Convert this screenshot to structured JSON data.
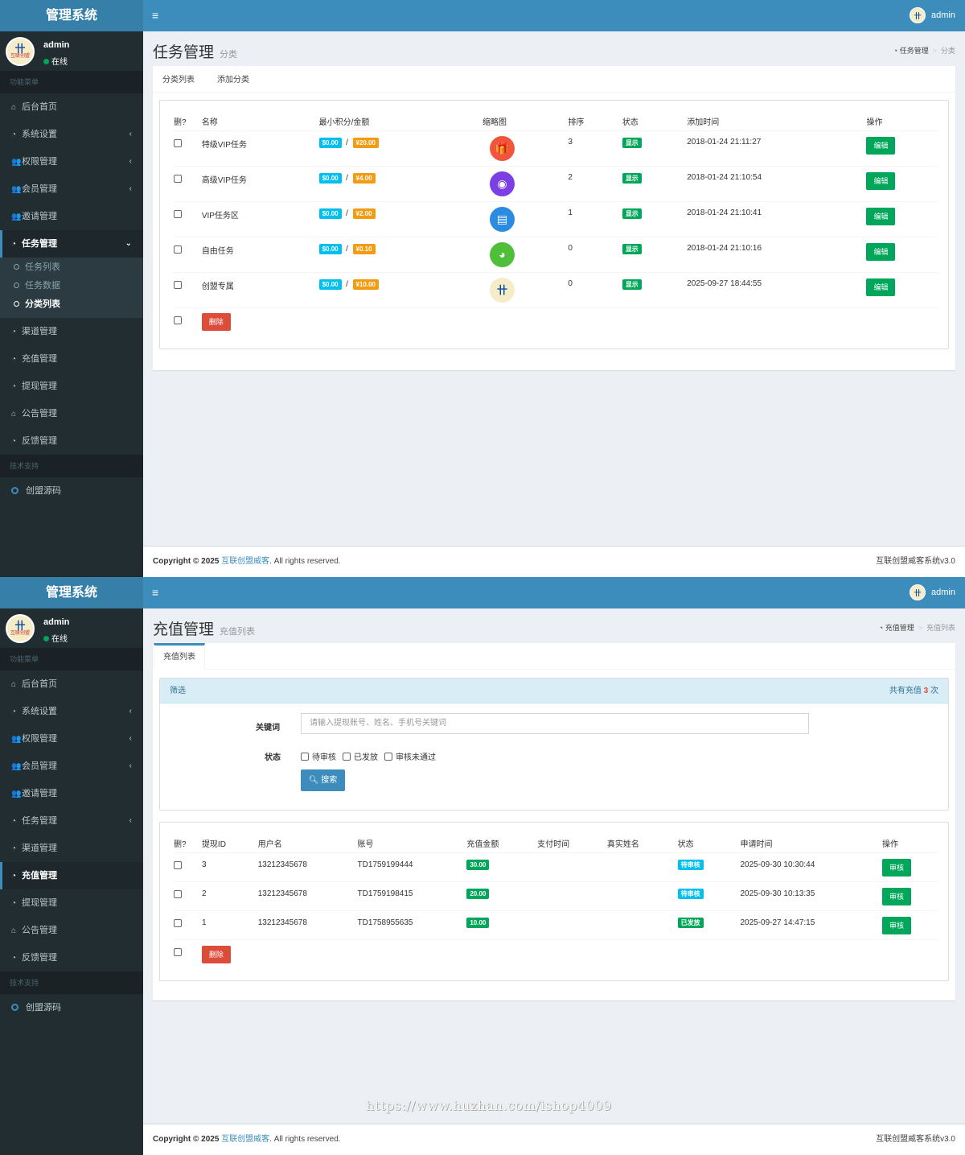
{
  "app_title": "管理系统",
  "user": {
    "name": "admin",
    "status": "在线"
  },
  "avatar_text": "互联创盟",
  "menu_header": "功能菜单",
  "support_header": "技术支持",
  "support_item": "创盟源码",
  "footer": {
    "copyright": "Copyright © 2025",
    "company": "互联创盟威客",
    "rights": ". All rights reserved.",
    "version": "互联创盟威客系统v3.0"
  },
  "screen1": {
    "title": "任务管理",
    "subtitle": "分类",
    "crumb": [
      "任务管理",
      "分类"
    ],
    "menu": [
      {
        "label": "后台首页",
        "icon": "home-icon",
        "chevron": false
      },
      {
        "label": "系统设置",
        "icon": "dashboard-icon",
        "chevron": true
      },
      {
        "label": "权限管理",
        "icon": "users-icon",
        "chevron": true
      },
      {
        "label": "会员管理",
        "icon": "users-icon",
        "chevron": true
      },
      {
        "label": "邀请管理",
        "icon": "users-icon",
        "chevron": false
      },
      {
        "label": "任务管理",
        "icon": "dashboard-icon",
        "chevron": true,
        "active": true
      }
    ],
    "submenu": [
      {
        "label": "任务列表"
      },
      {
        "label": "任务数据"
      },
      {
        "label": "分类列表",
        "active": true
      }
    ],
    "menu_after": [
      {
        "label": "渠道管理",
        "icon": "dashboard-icon"
      },
      {
        "label": "充值管理",
        "icon": "dashboard-icon"
      },
      {
        "label": "提现管理",
        "icon": "dashboard-icon"
      },
      {
        "label": "公告管理",
        "icon": "home-icon"
      },
      {
        "label": "反馈管理",
        "icon": "dashboard-icon"
      }
    ],
    "tabs": [
      "分类列表",
      "添加分类"
    ],
    "columns": [
      "删?",
      "名称",
      "最小积分/金额",
      "缩略图",
      "排序",
      "状态",
      "添加时间",
      "操作"
    ],
    "rows": [
      {
        "name": "特级VIP任务",
        "min_points": "$0.00",
        "amount": "¥20.00",
        "icon": "gift-icon",
        "color": "#f2553c",
        "order": "3",
        "status": "显示",
        "time": "2018-01-24 21:11:27",
        "action": "编辑"
      },
      {
        "name": "高级VIP任务",
        "min_points": "$0.00",
        "amount": "¥4.00",
        "icon": "qq-penguin-icon",
        "color": "#7b3fe4",
        "order": "2",
        "status": "显示",
        "time": "2018-01-24 21:10:54",
        "action": "编辑"
      },
      {
        "name": "VIP任务区",
        "min_points": "$0.00",
        "amount": "¥2.00",
        "icon": "document-icon",
        "color": "#2b8be0",
        "order": "1",
        "status": "显示",
        "time": "2018-01-24 21:10:41",
        "action": "编辑"
      },
      {
        "name": "自由任务",
        "min_points": "$0.00",
        "amount": "¥0.10",
        "icon": "wechat-icon",
        "color": "#4fbe3a",
        "order": "0",
        "status": "显示",
        "time": "2018-01-24 21:10:16",
        "action": "编辑"
      },
      {
        "name": "创盟专属",
        "min_points": "$0.00",
        "amount": "¥10.00",
        "icon": "logo-icon",
        "color": "#f5edc8",
        "order": "0",
        "status": "显示",
        "time": "2025-09-27 18:44:55",
        "action": "编辑"
      }
    ],
    "delete_label": "删除"
  },
  "screen2": {
    "title": "充值管理",
    "subtitle": "充值列表",
    "crumb": [
      "充值管理",
      "充值列表"
    ],
    "menu": [
      {
        "label": "后台首页",
        "icon": "home-icon",
        "chevron": false
      },
      {
        "label": "系统设置",
        "icon": "dashboard-icon",
        "chevron": true
      },
      {
        "label": "权限管理",
        "icon": "users-icon",
        "chevron": true
      },
      {
        "label": "会员管理",
        "icon": "users-icon",
        "chevron": true
      },
      {
        "label": "邀请管理",
        "icon": "users-icon",
        "chevron": false
      },
      {
        "label": "任务管理",
        "icon": "dashboard-icon",
        "chevron": true
      },
      {
        "label": "渠道管理",
        "icon": "dashboard-icon",
        "chevron": false
      },
      {
        "label": "充值管理",
        "icon": "dashboard-icon",
        "chevron": false,
        "active": true
      },
      {
        "label": "提现管理",
        "icon": "dashboard-icon",
        "chevron": false
      },
      {
        "label": "公告管理",
        "icon": "home-icon",
        "chevron": false
      },
      {
        "label": "反馈管理",
        "icon": "dashboard-icon",
        "chevron": false
      }
    ],
    "tabs": [
      "充值列表"
    ],
    "filter": {
      "title": "筛选",
      "total_prefix": "共有充值",
      "total_count": "3",
      "total_suffix": "次",
      "keyword_label": "关键词",
      "keyword_placeholder": "请输入提现账号、姓名、手机号关键词",
      "status_label": "状态",
      "status_options": [
        "待审核",
        "已发放",
        "审核未通过"
      ],
      "search_label": "搜索"
    },
    "columns": [
      "删?",
      "提现ID",
      "用户名",
      "账号",
      "充值金额",
      "支付时间",
      "真实姓名",
      "状态",
      "申请时间",
      "操作"
    ],
    "rows": [
      {
        "id": "3",
        "username": "13212345678",
        "account": "TD1759199444",
        "amount": "30.00",
        "pay_time": "",
        "real_name": "",
        "status": "待审核",
        "status_color": "#00c0ef",
        "apply_time": "2025-09-30 10:30:44",
        "action": "审核"
      },
      {
        "id": "2",
        "username": "13212345678",
        "account": "TD1759198415",
        "amount": "20.00",
        "pay_time": "",
        "real_name": "",
        "status": "待审核",
        "status_color": "#00c0ef",
        "apply_time": "2025-09-30 10:13:35",
        "action": "审核"
      },
      {
        "id": "1",
        "username": "13212345678",
        "account": "TD1758955635",
        "amount": "10.00",
        "pay_time": "",
        "real_name": "",
        "status": "已发放",
        "status_color": "#00a65a",
        "apply_time": "2025-09-27 14:47:15",
        "action": "审核"
      }
    ],
    "delete_label": "删除"
  },
  "watermark": "https://www.huzhan.com/ishop4009"
}
